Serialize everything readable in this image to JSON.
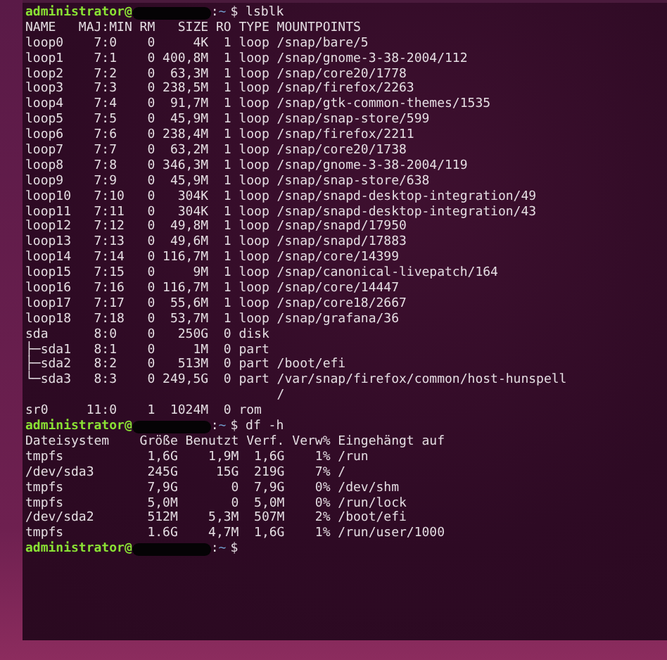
{
  "terminal": {
    "lines": [
      {
        "kind": "prompt",
        "user": "administrator@",
        "separator": ":",
        "path": "~",
        "symbol": "$",
        "command": "lsblk"
      },
      {
        "kind": "output",
        "text": "NAME   MAJ:MIN RM   SIZE RO TYPE MOUNTPOINTS"
      },
      {
        "kind": "output",
        "text": "loop0    7:0    0     4K  1 loop /snap/bare/5"
      },
      {
        "kind": "output",
        "text": "loop1    7:1    0 400,8M  1 loop /snap/gnome-3-38-2004/112"
      },
      {
        "kind": "output",
        "text": "loop2    7:2    0  63,3M  1 loop /snap/core20/1778"
      },
      {
        "kind": "output",
        "text": "loop3    7:3    0 238,5M  1 loop /snap/firefox/2263"
      },
      {
        "kind": "output",
        "text": "loop4    7:4    0  91,7M  1 loop /snap/gtk-common-themes/1535"
      },
      {
        "kind": "output",
        "text": "loop5    7:5    0  45,9M  1 loop /snap/snap-store/599"
      },
      {
        "kind": "output",
        "text": "loop6    7:6    0 238,4M  1 loop /snap/firefox/2211"
      },
      {
        "kind": "output",
        "text": "loop7    7:7    0  63,2M  1 loop /snap/core20/1738"
      },
      {
        "kind": "output",
        "text": "loop8    7:8    0 346,3M  1 loop /snap/gnome-3-38-2004/119"
      },
      {
        "kind": "output",
        "text": "loop9    7:9    0  45,9M  1 loop /snap/snap-store/638"
      },
      {
        "kind": "output",
        "text": "loop10   7:10   0   304K  1 loop /snap/snapd-desktop-integration/49"
      },
      {
        "kind": "output",
        "text": "loop11   7:11   0   304K  1 loop /snap/snapd-desktop-integration/43"
      },
      {
        "kind": "output",
        "text": "loop12   7:12   0  49,8M  1 loop /snap/snapd/17950"
      },
      {
        "kind": "output",
        "text": "loop13   7:13   0  49,6M  1 loop /snap/snapd/17883"
      },
      {
        "kind": "output",
        "text": "loop14   7:14   0 116,7M  1 loop /snap/core/14399"
      },
      {
        "kind": "output",
        "text": "loop15   7:15   0     9M  1 loop /snap/canonical-livepatch/164"
      },
      {
        "kind": "output",
        "text": "loop16   7:16   0 116,7M  1 loop /snap/core/14447"
      },
      {
        "kind": "output",
        "text": "loop17   7:17   0  55,6M  1 loop /snap/core18/2667"
      },
      {
        "kind": "output",
        "text": "loop18   7:18   0  53,7M  1 loop /snap/grafana/36"
      },
      {
        "kind": "output",
        "text": "sda      8:0    0   250G  0 disk"
      },
      {
        "kind": "output",
        "text": "├─sda1   8:1    0     1M  0 part"
      },
      {
        "kind": "output",
        "text": "├─sda2   8:2    0   513M  0 part /boot/efi"
      },
      {
        "kind": "output",
        "text": "└─sda3   8:3    0 249,5G  0 part /var/snap/firefox/common/host-hunspell"
      },
      {
        "kind": "output",
        "text": "                                 /"
      },
      {
        "kind": "output",
        "text": "sr0     11:0    1  1024M  0 rom"
      },
      {
        "kind": "prompt",
        "user": "administrator@",
        "separator": ":",
        "path": "~",
        "symbol": "$",
        "command": "df -h"
      },
      {
        "kind": "output",
        "text": "Dateisystem    Größe Benutzt Verf. Verw% Eingehängt auf"
      },
      {
        "kind": "output",
        "text": "tmpfs           1,6G    1,9M  1,6G    1% /run"
      },
      {
        "kind": "output",
        "text": "/dev/sda3       245G     15G  219G    7% /"
      },
      {
        "kind": "output",
        "text": "tmpfs           7,9G       0  7,9G    0% /dev/shm"
      },
      {
        "kind": "output",
        "text": "tmpfs           5,0M       0  5,0M    0% /run/lock"
      },
      {
        "kind": "output",
        "text": "/dev/sda2       512M    5,3M  507M    2% /boot/efi"
      },
      {
        "kind": "output",
        "text": "tmpfs           1.6G    4,7M  1,6G    1% /run/user/1000"
      },
      {
        "kind": "prompt",
        "user": "administrator@",
        "separator": ":",
        "path": "~",
        "symbol": "$"
      }
    ]
  }
}
